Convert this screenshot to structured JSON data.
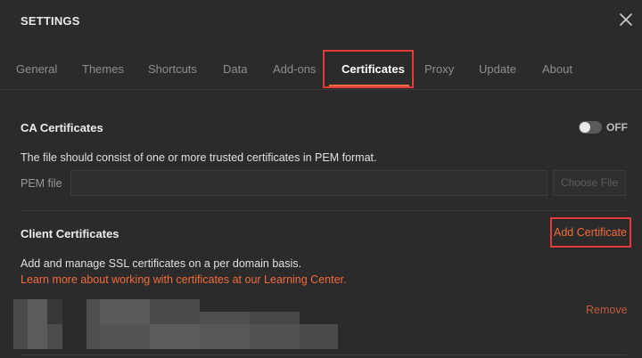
{
  "header": {
    "title": "SETTINGS",
    "close_icon": "close-icon"
  },
  "tabs": [
    {
      "label": "General"
    },
    {
      "label": "Themes"
    },
    {
      "label": "Shortcuts"
    },
    {
      "label": "Data"
    },
    {
      "label": "Add-ons"
    },
    {
      "label": "Certificates",
      "active": true
    },
    {
      "label": "Proxy"
    },
    {
      "label": "Update"
    },
    {
      "label": "About"
    }
  ],
  "ca": {
    "title": "CA Certificates",
    "toggle_label": "OFF",
    "description": "The file should consist of one or more trusted certificates in PEM format.",
    "pem_label": "PEM file",
    "pem_value": "",
    "choose_file_label": "Choose File"
  },
  "client": {
    "title": "Client Certificates",
    "add_label": "Add Certificate",
    "description": "Add and manage SSL certificates on a per domain basis.",
    "learn_more": "Learn more about working with certificates at our Learning Center.",
    "remove_label": "Remove"
  },
  "colors": {
    "accent": "#f26b3a",
    "highlight_box": "#e03c3c",
    "background": "#2b2b2b"
  }
}
